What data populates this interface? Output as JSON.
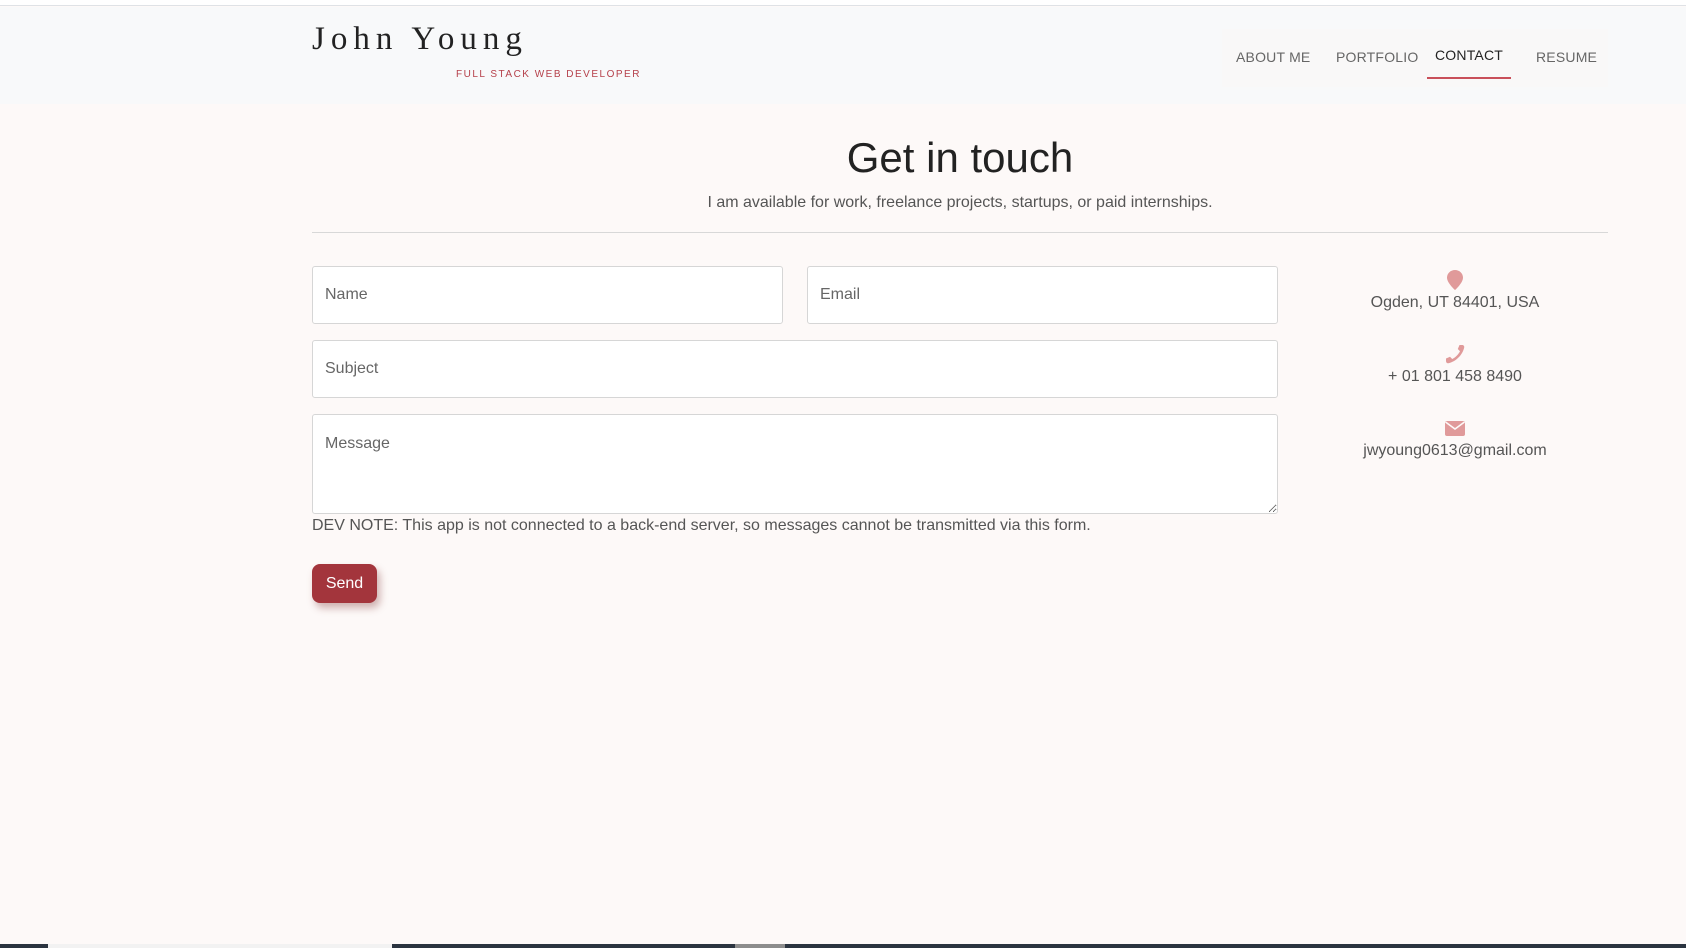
{
  "brand": {
    "name": "John Young",
    "tagline": "FULL STACK WEB DEVELOPER"
  },
  "nav": {
    "items": [
      {
        "label": "ABOUT ME"
      },
      {
        "label": "PORTFOLIO"
      },
      {
        "label": "CONTACT"
      },
      {
        "label": "RESUME"
      }
    ],
    "active": "CONTACT"
  },
  "contact": {
    "title": "Get in touch",
    "subtitle": "I am available for work, freelance projects, startups, or paid internships.",
    "form": {
      "name_placeholder": "Name",
      "email_placeholder": "Email",
      "subject_placeholder": "Subject",
      "message_placeholder": "Message",
      "dev_note": "DEV NOTE: This app is not connected to a back-end server, so messages cannot be transmitted via this form.",
      "send_label": "Send"
    },
    "info": {
      "location": "Ogden, UT 84401, USA",
      "phone": "+ 01 801 458 8490",
      "email": "jwyoung0613@gmail.com"
    }
  },
  "colors": {
    "accent": "#a3353c",
    "icon": "#e09a9a",
    "page_bg": "#fdf9f8",
    "header_bg": "#f8f9fa"
  },
  "icons": {
    "location": "map-marker-icon",
    "phone": "phone-icon",
    "email": "envelope-icon"
  }
}
